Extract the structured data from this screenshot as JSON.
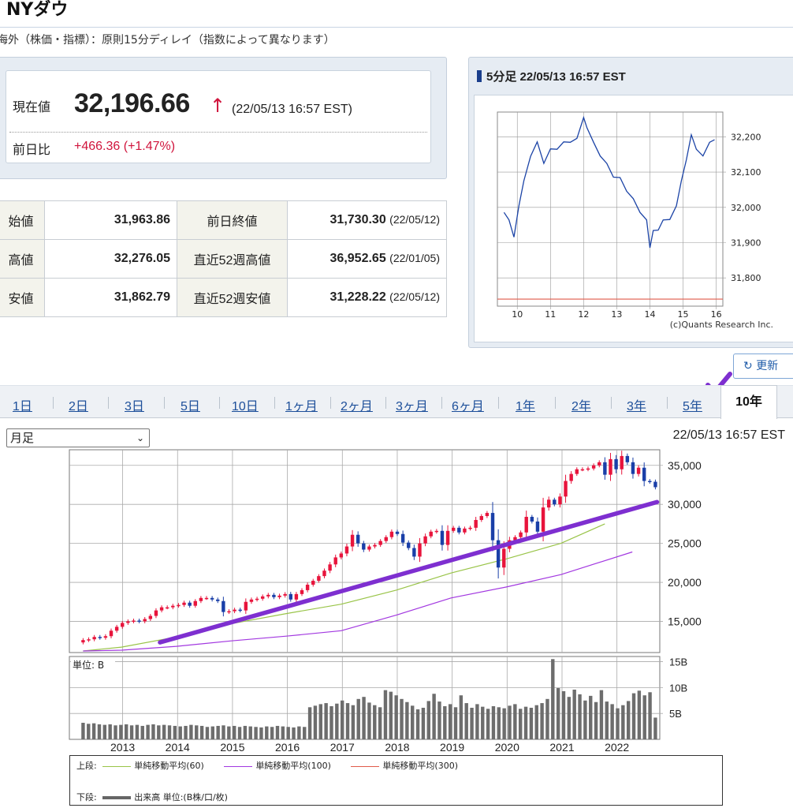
{
  "page": {
    "title": "NYダウ",
    "notice": "海外（株価・指標）：原則15分ディレイ（指数によって異なります）"
  },
  "quote": {
    "current_label": "現在値",
    "current_value": "32,196.66",
    "direction_icon": "up-arrow-icon",
    "current_time": "(22/05/13 16:57 EST)",
    "change_label": "前日比",
    "change_value": "+466.36",
    "change_percent": "(+1.47%)",
    "up_color": "#d0143c"
  },
  "stats": [
    {
      "label": "始値",
      "value": "31,963.86",
      "label2": "前日終値",
      "value2": "31,730.30",
      "date2": "(22/05/12)"
    },
    {
      "label": "高値",
      "value": "32,276.05",
      "label2": "直近52週高値",
      "value2": "36,952.65",
      "date2": "(22/01/05)"
    },
    {
      "label": "安値",
      "value": "31,862.79",
      "label2": "直近52週安値",
      "value2": "31,228.22",
      "date2": "(22/05/12)"
    }
  ],
  "intraday": {
    "heading": "5分足 22/05/13 16:57 EST",
    "credit": "(c)Quants Research Inc.",
    "y_ticks": [
      "32,200",
      "32,100",
      "32,000",
      "31,900",
      "31,800"
    ],
    "x_ticks": [
      "10",
      "11",
      "12",
      "13",
      "14",
      "15",
      "16"
    ]
  },
  "refresh_label": "更新",
  "periods": [
    "1日",
    "2日",
    "3日",
    "5日",
    "10日",
    "1ヶ月",
    "2ヶ月",
    "3ヶ月",
    "6ヶ月",
    "1年",
    "2年",
    "3年",
    "5年",
    "10年"
  ],
  "active_period": "10年",
  "frequency": {
    "selected": "月足"
  },
  "chart_time": "22/05/13 16:57 EST",
  "chart_data": [
    {
      "type": "line",
      "title": "NYダウ 5分足 22/05/13",
      "x_ticks": [
        "10",
        "11",
        "12",
        "13",
        "14",
        "15",
        "16"
      ],
      "y_ticks": [
        32200,
        32100,
        32000,
        31900,
        31800
      ],
      "ylim": [
        31720,
        32270
      ],
      "x": [
        9.6,
        9.75,
        9.9,
        10.05,
        10.2,
        10.4,
        10.6,
        10.8,
        11.0,
        11.2,
        11.4,
        11.6,
        11.8,
        12.0,
        12.1,
        12.3,
        12.5,
        12.7,
        12.9,
        13.1,
        13.3,
        13.5,
        13.7,
        13.9,
        14.0,
        14.1,
        14.25,
        14.4,
        14.6,
        14.8,
        14.95,
        15.1,
        15.25,
        15.4,
        15.6,
        15.8,
        15.95
      ],
      "values": [
        31990,
        31960,
        31920,
        32000,
        32080,
        32140,
        32190,
        32120,
        32170,
        32160,
        32190,
        32180,
        32200,
        32250,
        32230,
        32180,
        32150,
        32120,
        32090,
        32080,
        32050,
        32020,
        31990,
        31960,
        31890,
        31930,
        31940,
        31960,
        31970,
        32000,
        32080,
        32130,
        32210,
        32160,
        32150,
        32180,
        32196
      ]
    },
    {
      "type": "candlestick",
      "title": "NYダウ 月足 10年",
      "x_ticks": [
        "2013",
        "2014",
        "2015",
        "2016",
        "2017",
        "2018",
        "2019",
        "2020",
        "2021",
        "2022"
      ],
      "y_ticks": [
        35000,
        30000,
        25000,
        20000,
        15000
      ],
      "ylim": [
        11000,
        37000
      ],
      "grid": true,
      "close": [
        12600,
        12700,
        13000,
        12900,
        13100,
        13800,
        14300,
        14800,
        15000,
        15100,
        15000,
        15300,
        15700,
        16400,
        16800,
        16800,
        17000,
        17100,
        17400,
        17000,
        17600,
        18000,
        18000,
        17800,
        17600,
        16200,
        16300,
        16500,
        16400,
        17500,
        17800,
        17900,
        18200,
        18400,
        18100,
        18300,
        18500,
        17800,
        18500,
        19000,
        19700,
        20200,
        20800,
        21500,
        22300,
        23200,
        23700,
        24600,
        26100,
        25000,
        24200,
        24600,
        24800,
        25300,
        25800,
        26500,
        26200,
        25100,
        24400,
        23300,
        24999,
        25900,
        26500,
        26600,
        24800,
        26600,
        27000,
        26400,
        26900,
        27000,
        28000,
        28500,
        28900,
        25400,
        21900,
        24300,
        25400,
        25800,
        26400,
        28400,
        27800,
        26500,
        29600,
        30600,
        30000,
        31000,
        33000,
        33900,
        34500,
        34500,
        34600,
        35000,
        35400,
        33800,
        35800,
        34500,
        36200,
        35400,
        33900,
        34700,
        33000,
        32900,
        32200
      ],
      "series": [
        {
          "name": "単純移動平均(60)",
          "color": "#99c448"
        },
        {
          "name": "単純移動平均(100)",
          "color": "#a238e0"
        },
        {
          "name": "単純移動平均(300)",
          "color": "#e05a4a"
        }
      ],
      "ma60": {
        "x": [
          2012.3,
          2013,
          2014,
          2015,
          2016,
          2017,
          2018,
          2019,
          2020,
          2021,
          2021.8
        ],
        "values": [
          11200,
          11700,
          13000,
          14700,
          16000,
          17200,
          19000,
          21200,
          23000,
          25000,
          27500
        ]
      },
      "ma100": {
        "x": [
          2012.3,
          2013,
          2014,
          2015,
          2016,
          2017,
          2018,
          2019,
          2020,
          2021,
          2022.3
        ],
        "values": [
          11200,
          11300,
          11800,
          12500,
          13100,
          13800,
          15800,
          18000,
          19400,
          21000,
          23900
        ]
      }
    },
    {
      "type": "bar",
      "title": "出来高",
      "unit_label": "単位: B",
      "y_ticks": [
        "15B",
        "10B",
        "5B"
      ],
      "ylim": [
        0,
        16
      ],
      "values": [
        3.2,
        3.0,
        3.1,
        2.9,
        2.8,
        2.9,
        2.7,
        2.8,
        2.9,
        2.7,
        2.8,
        2.6,
        2.8,
        2.9,
        2.7,
        2.8,
        2.7,
        2.6,
        2.5,
        2.6,
        2.8,
        2.7,
        2.6,
        2.4,
        2.5,
        2.6,
        2.7,
        2.5,
        2.6,
        2.4,
        2.6,
        2.5,
        2.4,
        2.3,
        2.5,
        2.4,
        2.6,
        2.5,
        2.4,
        2.3,
        2.5,
        2.4,
        6.2,
        6.5,
        6.8,
        7.0,
        6.4,
        6.9,
        7.5,
        7.0,
        6.6,
        7.8,
        8.2,
        7.1,
        6.6,
        6.2,
        9.5,
        9.2,
        8.5,
        7.8,
        7.2,
        6.5,
        5.8,
        6.1,
        7.4,
        8.8,
        7.3,
        6.4,
        6.8,
        6.2,
        8.5,
        7.0,
        6.1,
        6.8,
        6.3,
        5.9,
        6.4,
        6.2,
        6.0,
        6.5,
        6.8,
        5.9,
        6.3,
        6.1,
        6.6,
        7.0,
        7.8,
        15.5,
        9.9,
        9.3,
        8.2,
        9.6,
        8.7,
        7.5,
        8.4,
        7.2,
        9.5,
        7.3,
        6.8,
        6.0,
        6.6,
        7.4,
        8.9,
        9.4,
        8.5,
        9.1,
        4.2
      ],
      "legend": "出来高 単位:(B株/口/枚)",
      "x_ticks": [
        "2013",
        "2014",
        "2015",
        "2016",
        "2017",
        "2018",
        "2019",
        "2020",
        "2021",
        "2022"
      ]
    }
  ],
  "legend": {
    "upper_label": "上段:",
    "lower_label": "下段:",
    "ma60": "単純移動平均(60)",
    "ma100": "単純移動平均(100)",
    "ma300": "単純移動平均(300)",
    "volume": "出来高 単位:(B株/口/枚)"
  },
  "annotation": {
    "trend_color": "#7e2fd0",
    "check_icon": "check-mark-icon"
  }
}
